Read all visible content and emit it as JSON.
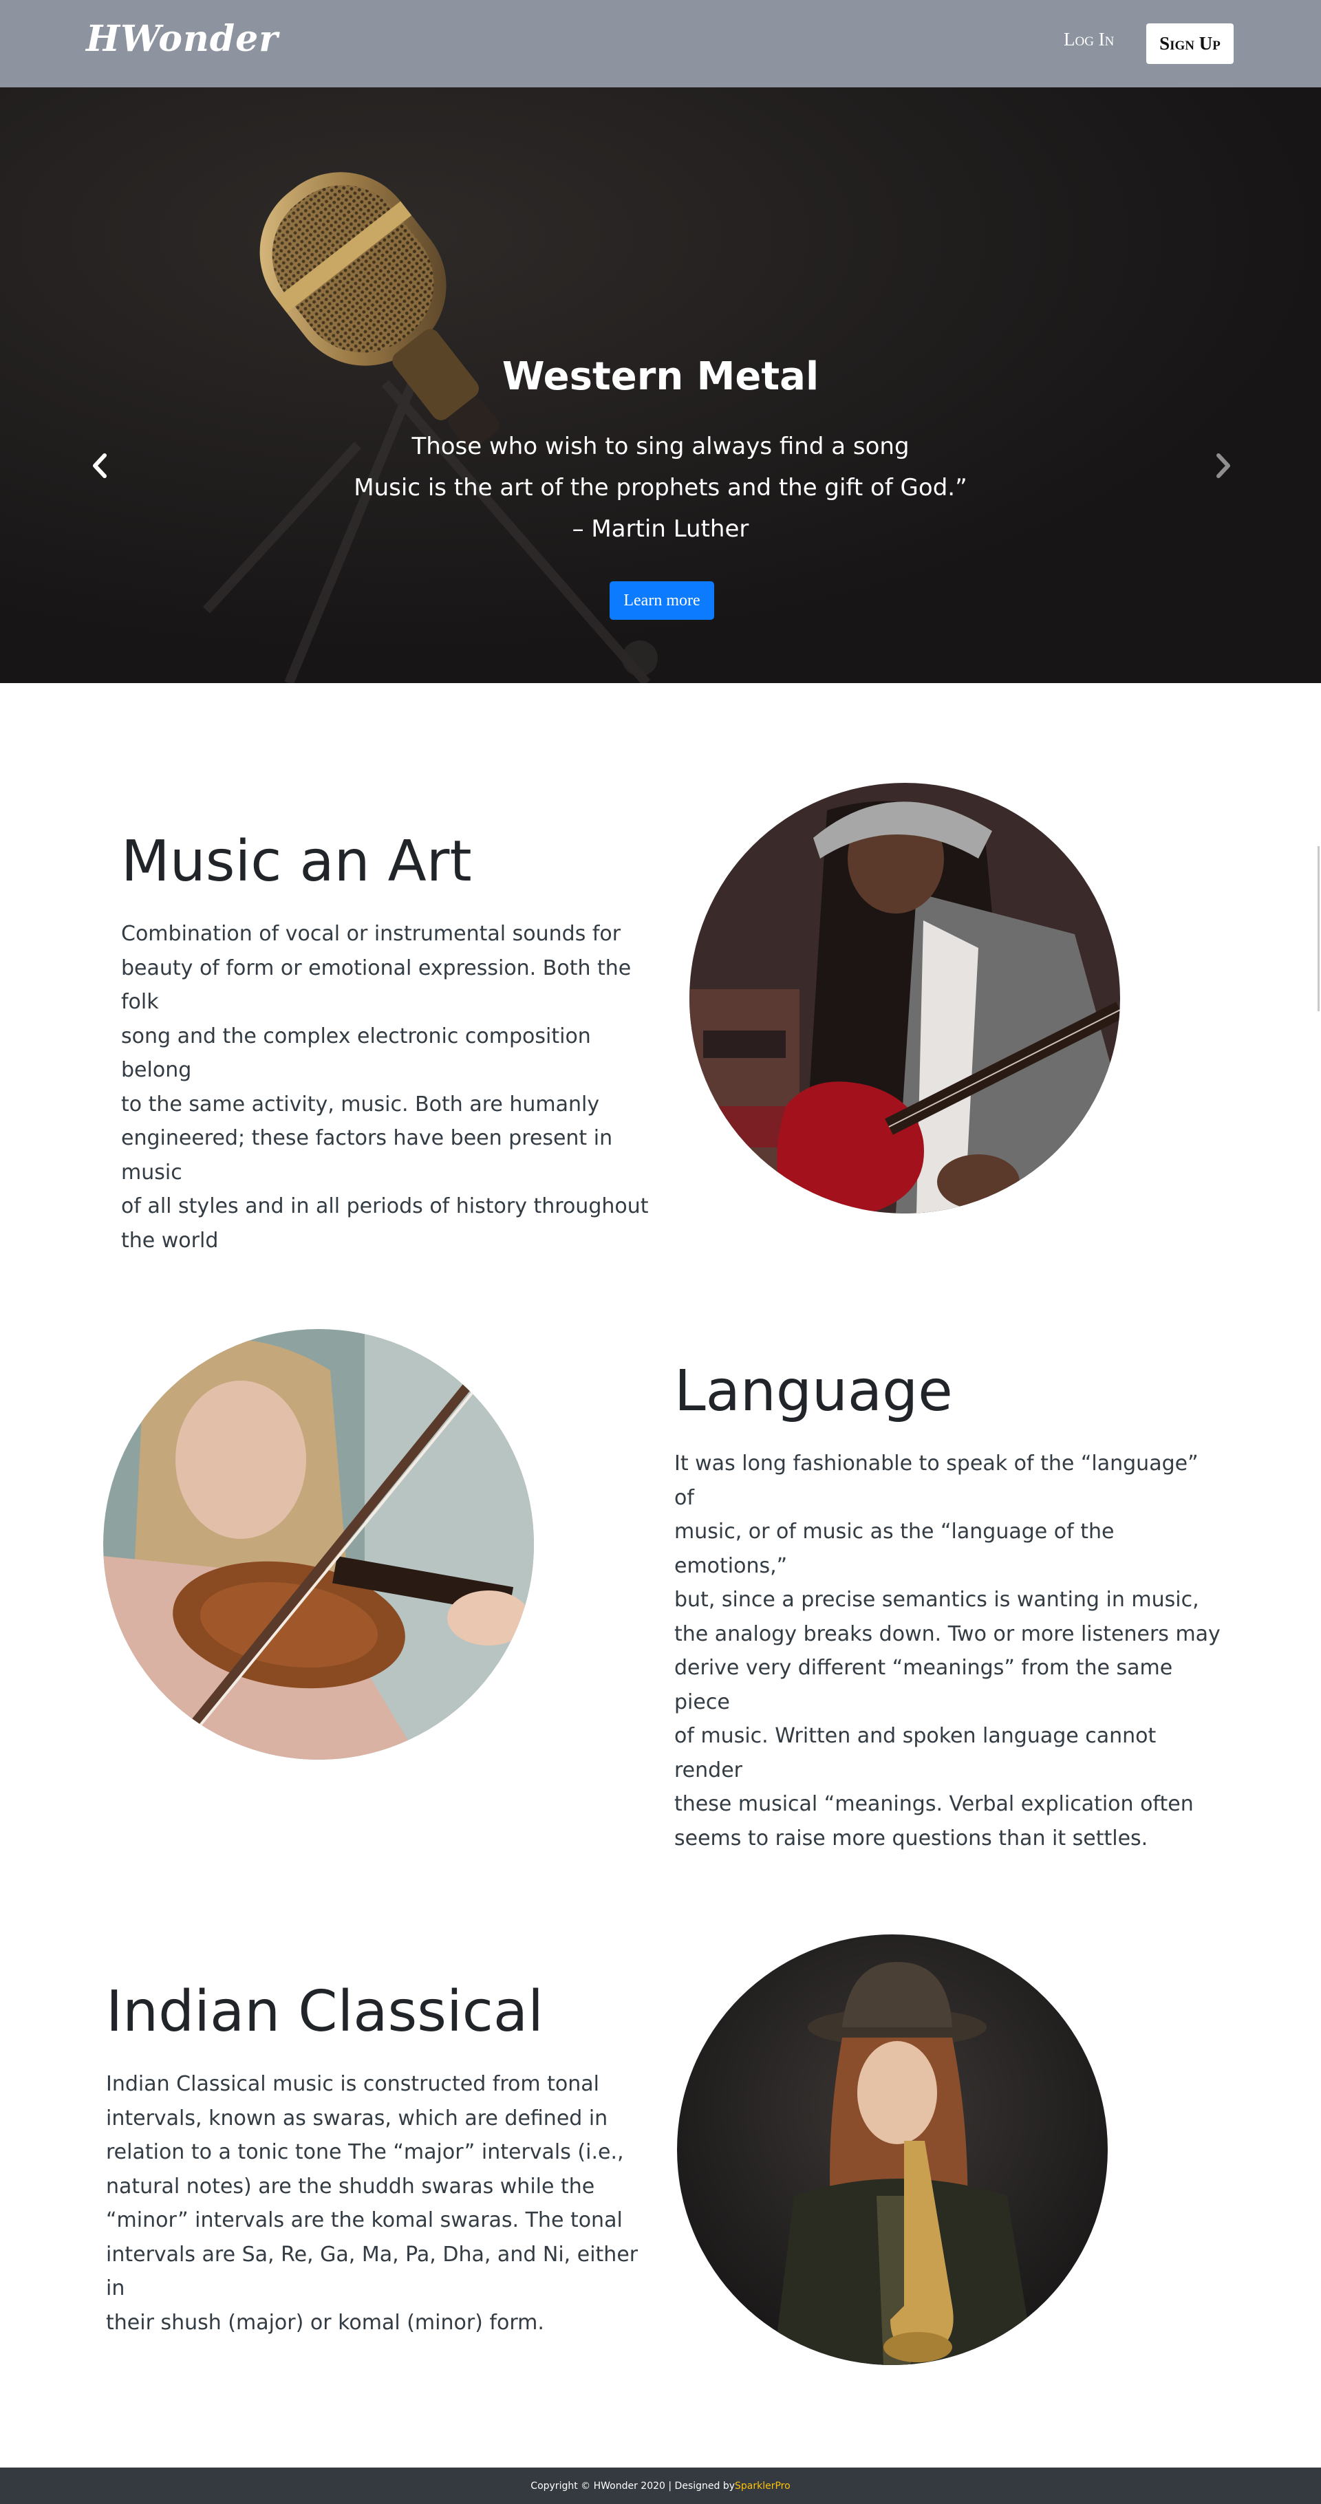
{
  "navbar": {
    "brand": "HWonder",
    "login_label": "Log In",
    "signup_label": "Sign Up",
    "background": "#8d949f"
  },
  "hero": {
    "title": "Western Metal",
    "quote": [
      "Those who wish to sing always find a song",
      "Music is the art of the prophets and the gift of God.”",
      "– Martin Luther"
    ],
    "button_label": "Learn more",
    "button_color": "#0d7bff",
    "prev_icon": "chevron-left-icon",
    "next_icon": "chevron-right-icon"
  },
  "sections": [
    {
      "title": "Music an Art",
      "lines": [
        "Combination of vocal or instrumental sounds for",
        "beauty of form or emotional expression. Both the folk",
        "song and the complex electronic composition belong",
        "to the same activity, music. Both are humanly",
        "engineered; these factors have been present in music",
        "of all styles and in all periods of history throughout",
        "the world"
      ]
    },
    {
      "title": "Language",
      "lines": [
        "It was long fashionable to speak of the “language” of",
        "music, or of music as the “language of the emotions,”",
        "but, since a precise semantics is wanting in music,",
        "the analogy breaks down. Two or more listeners may",
        "derive very different “meanings” from the same piece",
        "of music. Written and spoken language cannot render",
        "these musical “meanings. Verbal explication often",
        "seems to raise more questions than it settles."
      ]
    },
    {
      "title": "Indian Classical",
      "lines": [
        "Indian Classical music is constructed from tonal",
        "intervals, known as swaras, which are defined in",
        "relation to a tonic tone The “major” intervals (i.e.,",
        "natural notes) are the shuddh swaras while the",
        "“minor” intervals are the komal swaras. The tonal",
        "intervals are Sa, Re, Ga, Ma, Pa, Dha, and Ni, either in",
        "their shush (major) or komal (minor) form."
      ]
    }
  ],
  "footer": {
    "copyright": "Copyright © HWonder 2020 | Designed by ",
    "designer": "SparklerPro",
    "designer_color": "#ffc107"
  }
}
